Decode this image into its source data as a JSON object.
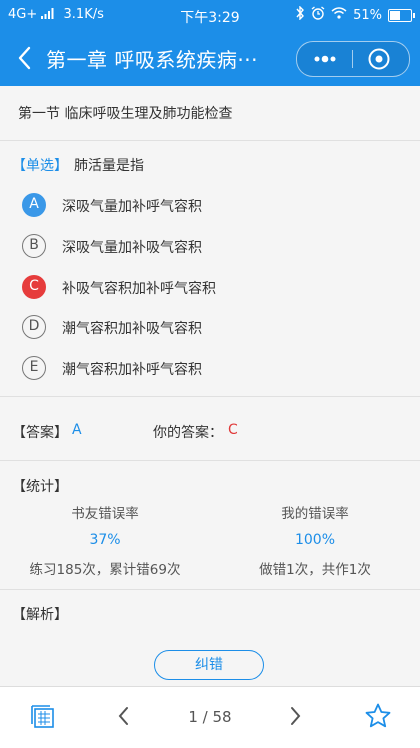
{
  "status_bar": {
    "network": "4G+",
    "speed": "3.1K/s",
    "time": "下午3:29",
    "battery": "51%"
  },
  "title_bar": {
    "title": "第一章 呼吸系统疾病···"
  },
  "section": {
    "title": "第一节 临床呼吸生理及肺功能检查"
  },
  "question": {
    "type_tag": "【单选】",
    "text": "肺活量是指",
    "options": [
      {
        "letter": "A",
        "text": "深吸气量加补呼气容积",
        "state": "correct"
      },
      {
        "letter": "B",
        "text": "深吸气量加补吸气容积",
        "state": "none"
      },
      {
        "letter": "C",
        "text": "补吸气容积加补呼气容积",
        "state": "wrong"
      },
      {
        "letter": "D",
        "text": "潮气容积加补吸气容积",
        "state": "none"
      },
      {
        "letter": "E",
        "text": "潮气容积加补呼气容积",
        "state": "none"
      }
    ]
  },
  "answer": {
    "label": "【答案】",
    "value": "A",
    "your_label": "你的答案：",
    "your_value": "C"
  },
  "stats": {
    "label": "【统计】",
    "friends_title": "书友错误率",
    "friends_rate": "37%",
    "friends_detail": "练习185次，累计错69次",
    "mine_title": "我的错误率",
    "mine_rate": "100%",
    "mine_detail": "做错1次，共作1次"
  },
  "analysis": {
    "label": "【解析】"
  },
  "feedback_button": "纠错",
  "bottom_bar": {
    "page": "1 / 58"
  },
  "colors": {
    "primary": "#1c8ee8",
    "correct": "#3a98e8",
    "wrong": "#e63c3c"
  }
}
